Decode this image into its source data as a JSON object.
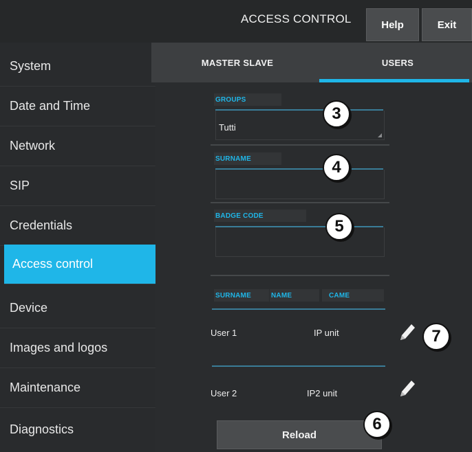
{
  "header": {
    "title": "ACCESS CONTROL",
    "help_label": "Help",
    "exit_label": "Exit"
  },
  "sidebar": {
    "items": [
      {
        "label": "System",
        "active": false
      },
      {
        "label": "Date and Time",
        "active": false
      },
      {
        "label": "Network",
        "active": false
      },
      {
        "label": "SIP",
        "active": false
      },
      {
        "label": "Credentials",
        "active": false
      },
      {
        "label": "Access control",
        "active": true
      },
      {
        "label": "Device",
        "active": false
      },
      {
        "label": "Images and logos",
        "active": false
      },
      {
        "label": "Maintenance",
        "active": false
      },
      {
        "label": "Diagnostics",
        "active": false
      }
    ]
  },
  "tabs": [
    {
      "label": "MASTER SLAVE",
      "active": false
    },
    {
      "label": "USERS",
      "active": true
    }
  ],
  "form": {
    "groups": {
      "label": "GROUPS",
      "value": "Tutti"
    },
    "surname": {
      "label": "SURNAME",
      "value": ""
    },
    "badge_code": {
      "label": "BADGE CODE",
      "value": ""
    }
  },
  "table": {
    "columns": [
      "SURNAME",
      "NAME",
      "CAME"
    ],
    "rows": [
      {
        "surname": "User 1",
        "unit": "IP unit"
      },
      {
        "surname": "User 2",
        "unit": "IP2 unit"
      }
    ]
  },
  "reload_label": "Reload",
  "callouts": [
    "3",
    "4",
    "5",
    "7",
    "6"
  ],
  "colors": {
    "accent": "#1fb6e8",
    "background": "#2a2c2e",
    "button": "#4a4c4e"
  }
}
